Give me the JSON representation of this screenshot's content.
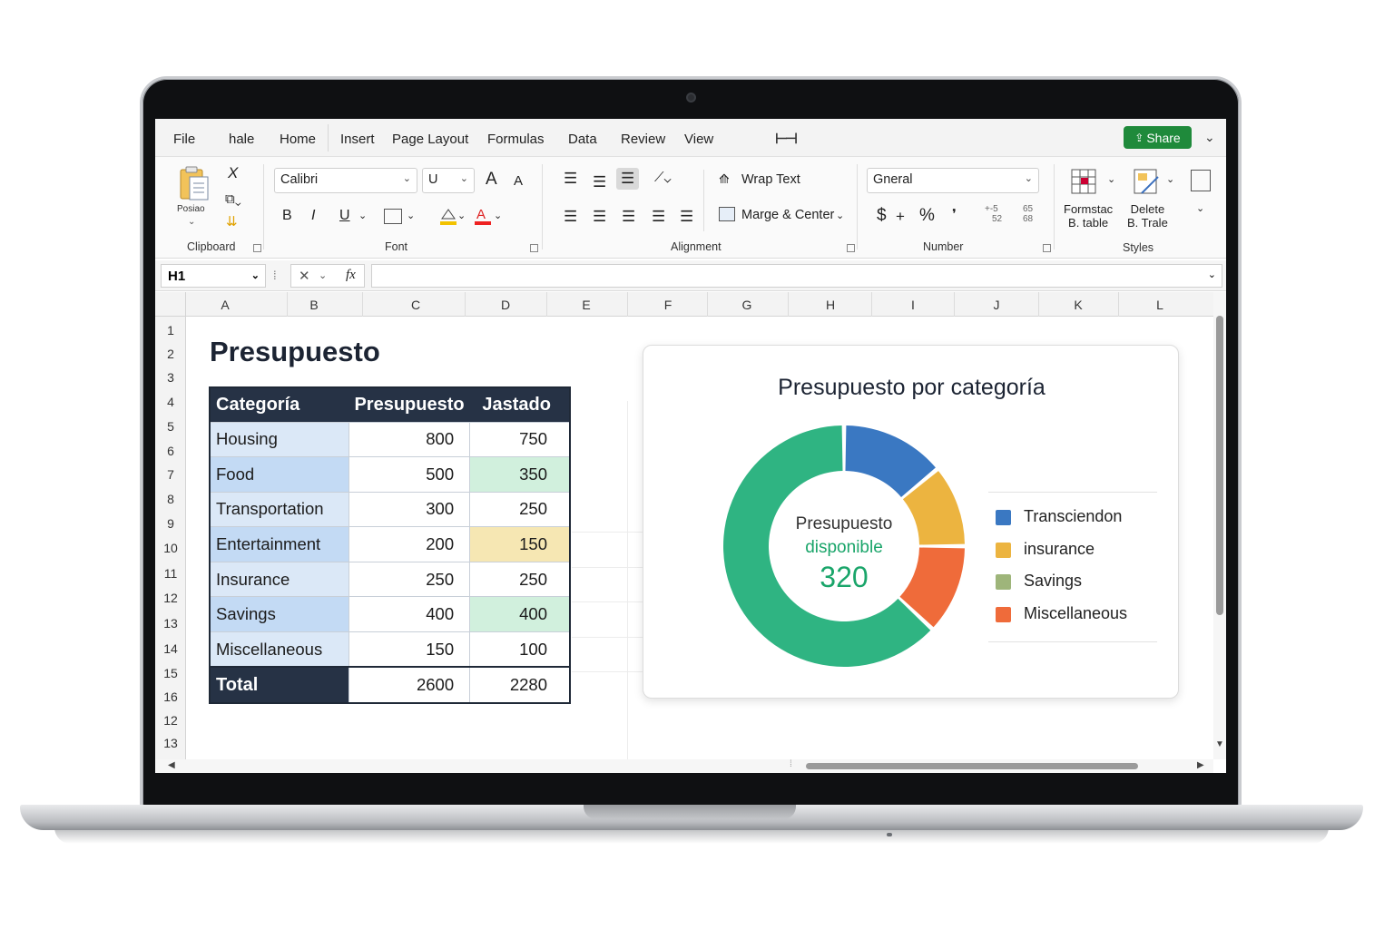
{
  "menu": {
    "items": [
      "File",
      "hale",
      "Home",
      "Insert",
      "Page Layout",
      "Formulas",
      "Data",
      "Review",
      "View"
    ],
    "share_label": "Share"
  },
  "ribbon": {
    "clipboard": {
      "paste_label": "Posiao",
      "group_label": "Clipboard"
    },
    "font": {
      "family": "Calibri",
      "size": "U",
      "group_label": "Font",
      "grow": "A",
      "shrink": "A",
      "bold": "B",
      "italic": "I",
      "underline": "U"
    },
    "alignment": {
      "wrap_text": "Wrap Text",
      "merge_center": "Marge & Center",
      "group_label": "Alignment"
    },
    "number": {
      "format": "Gneral",
      "currency": "$",
      "plus": "+",
      "percent": "%",
      "group_label": "Number",
      "inc_dec_top": "+-5",
      "inc_dec_bottom": "52",
      "dec_top": "65",
      "dec_bottom": "68"
    },
    "styles": {
      "format_table_line1": "Formstac",
      "format_table_line2": "B. table",
      "delete_line1": "Delete",
      "delete_line2": "B. Trale",
      "group_label": "Styles"
    }
  },
  "formula_bar": {
    "name_box": "H1",
    "fx": "fx",
    "content": ""
  },
  "columns": [
    "A",
    "B",
    "C",
    "D",
    "E",
    "F",
    "G",
    "H",
    "I",
    "J",
    "K",
    "L"
  ],
  "rows": [
    "1",
    "2",
    "3",
    "4",
    "5",
    "6",
    "7",
    "8",
    "9",
    "10",
    "11",
    "12",
    "13",
    "14",
    "15",
    "16",
    "12",
    "13"
  ],
  "sheet": {
    "title": "Presupuesto",
    "table": {
      "headers": [
        "Categoría",
        "Presupuesto",
        "Jastado"
      ],
      "rows": [
        [
          "Housing",
          "800",
          "750"
        ],
        [
          "Food",
          "500",
          "350"
        ],
        [
          "Transportation",
          "300",
          "250"
        ],
        [
          "Entertainment",
          "200",
          "150"
        ],
        [
          "Insurance",
          "250",
          "250"
        ],
        [
          "Savings",
          "400",
          "400"
        ],
        [
          "Miscellaneous",
          "150",
          "100"
        ]
      ],
      "total": [
        "Total",
        "2600",
        "2280"
      ]
    }
  },
  "chart": {
    "title": "Presupuesto por categoría",
    "center_label_1": "Presupuesto",
    "center_label_2": "disponible",
    "center_value": "320",
    "legend": [
      "Transciendon",
      "insurance",
      "Savings",
      "Miscellaneous"
    ]
  },
  "chart_data": {
    "type": "pie",
    "title": "Presupuesto por categoría",
    "series": [
      {
        "name": "Transciendon",
        "value": 14,
        "color": "#3a78c2"
      },
      {
        "name": "insurance",
        "value": 11,
        "color": "#ecb440"
      },
      {
        "name": "",
        "value": 12,
        "color": "#ef6b3a"
      },
      {
        "name": "",
        "value": 63,
        "color": "#2fb482"
      }
    ],
    "legend_colors": [
      "#3a78c2",
      "#ecb440",
      "#9eb57a",
      "#ef6b3a"
    ],
    "legend_placement": "right"
  },
  "colors": {
    "share": "#1f8a3b",
    "table_header": "#263245",
    "accent_green": "#1aa56a"
  }
}
